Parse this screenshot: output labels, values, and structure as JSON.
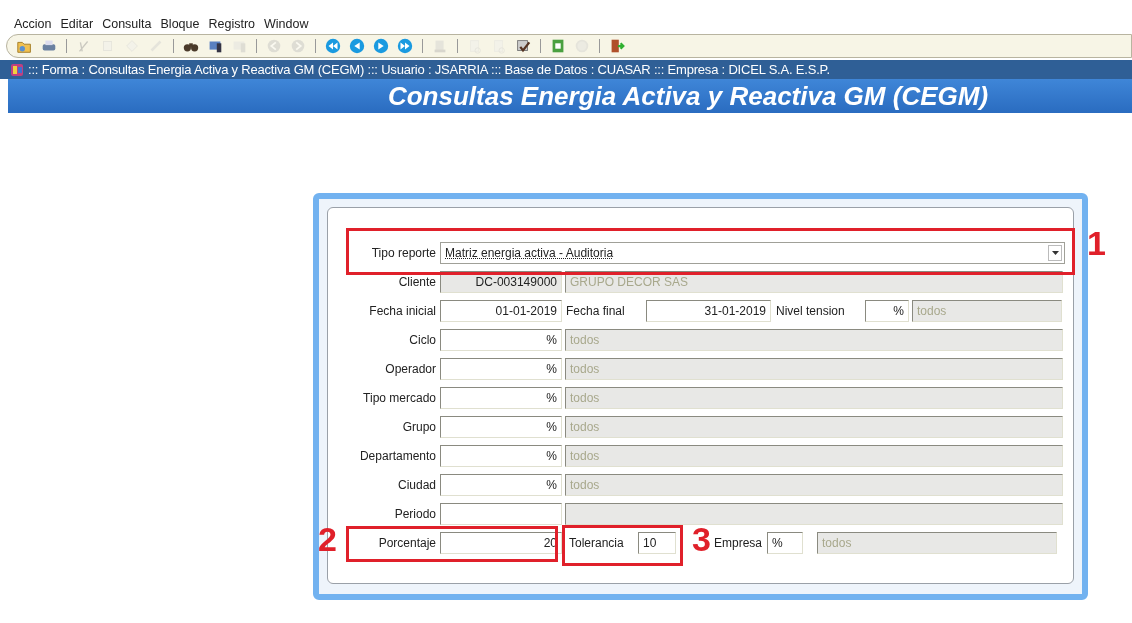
{
  "menu": [
    "Accion",
    "Editar",
    "Consulta",
    "Bloque",
    "Registro",
    "Window"
  ],
  "toolbar": [
    {
      "kind": "button",
      "disabled": false
    },
    {
      "kind": "button",
      "disabled": false
    },
    {
      "kind": "separator"
    },
    {
      "kind": "button",
      "disabled": true
    },
    {
      "kind": "button",
      "disabled": true
    },
    {
      "kind": "button",
      "disabled": true
    },
    {
      "kind": "button",
      "disabled": true
    },
    {
      "kind": "separator"
    },
    {
      "kind": "button",
      "disabled": false
    },
    {
      "kind": "button",
      "disabled": false
    },
    {
      "kind": "button",
      "disabled": true
    },
    {
      "kind": "separator"
    },
    {
      "kind": "button",
      "disabled": true
    },
    {
      "kind": "button",
      "disabled": true
    },
    {
      "kind": "separator"
    },
    {
      "kind": "button",
      "disabled": false
    },
    {
      "kind": "button",
      "disabled": false
    },
    {
      "kind": "button",
      "disabled": false
    },
    {
      "kind": "button",
      "disabled": false
    },
    {
      "kind": "separator"
    },
    {
      "kind": "button",
      "disabled": true
    },
    {
      "kind": "separator"
    },
    {
      "kind": "button",
      "disabled": true
    },
    {
      "kind": "button",
      "disabled": true
    },
    {
      "kind": "button",
      "disabled": false
    },
    {
      "kind": "separator"
    },
    {
      "kind": "button",
      "disabled": false
    },
    {
      "kind": "button",
      "disabled": true
    },
    {
      "kind": "separator"
    },
    {
      "kind": "button",
      "disabled": false
    }
  ],
  "window": {
    "title": "::: Forma : Consultas Energia Activa y Reactiva GM (CEGM) ::: Usuario : JSARRIA ::: Base de Datos : CUASAR ::: Empresa : DICEL S.A. E.S.P."
  },
  "form": {
    "heading": "Consultas Energia Activa y Reactiva GM (CEGM)",
    "report_type": {
      "label": "Tipo reporte",
      "value": "Matriz energia activa - Auditoria"
    },
    "rows": [
      {
        "kind": "lookup",
        "label": "Cliente",
        "code": "DC-003149000",
        "description": "GRUPO DECOR SAS",
        "disabled": true
      },
      {
        "kind": "triple",
        "label": "Fecha inicial",
        "value": "01-01-2019",
        "label_2": "Fecha final",
        "value_2": "31-01-2019",
        "label_3": "Nivel tension",
        "code": "%",
        "description": "todos"
      },
      {
        "kind": "lookup",
        "label": "Ciclo",
        "code": "%",
        "description": "todos",
        "disabled": false
      },
      {
        "kind": "lookup",
        "label": "Operador",
        "code": "%",
        "description": "todos",
        "disabled": false
      },
      {
        "kind": "lookup",
        "label": "Tipo mercado",
        "code": "%",
        "description": "todos",
        "disabled": false
      },
      {
        "kind": "lookup",
        "label": "Grupo",
        "code": "%",
        "description": "todos",
        "disabled": false
      },
      {
        "kind": "lookup",
        "label": "Departamento",
        "code": "%",
        "description": "todos",
        "disabled": false
      },
      {
        "kind": "lookup",
        "label": "Ciudad",
        "code": "%",
        "description": "todos",
        "disabled": false
      },
      {
        "kind": "lookup",
        "label": "Periodo",
        "disabled": false
      },
      {
        "kind": "percent",
        "label": "Porcentaje",
        "value": "20",
        "label_2": "Tolerancia",
        "value_2": "10",
        "label_3": "Empresa",
        "code": "%",
        "description": "todos"
      }
    ]
  },
  "annotations": [
    {
      "label": "1"
    },
    {
      "label": "2"
    },
    {
      "label": "3"
    }
  ]
}
